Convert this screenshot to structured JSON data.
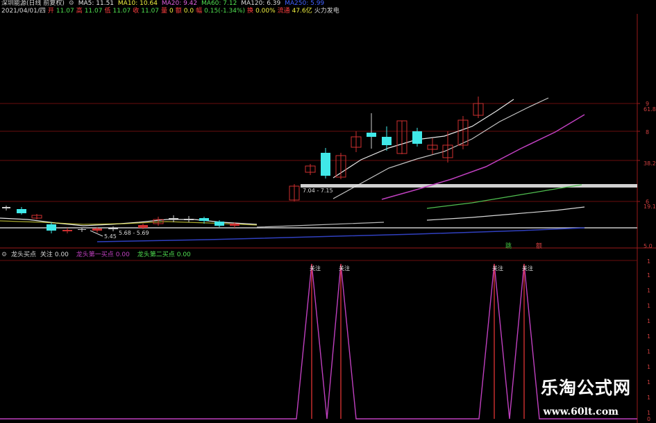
{
  "header": {
    "title": "深圳能源(日线 前复权)",
    "ma": [
      {
        "label": "MA5: 11.51",
        "color": "#e8e8e8"
      },
      {
        "label": "MA10: 10.64",
        "color": "#f0f040"
      },
      {
        "label": "MA20: 9.42",
        "color": "#e060e0"
      },
      {
        "label": "MA60: 7.12",
        "color": "#50e050"
      },
      {
        "label": "MA120: 6.39",
        "color": "#d8d8d8"
      },
      {
        "label": "MA250: 5.99",
        "color": "#4060ff"
      }
    ],
    "date": "2021/04/01/四",
    "open_label": "开",
    "open": "11.07",
    "high_label": "高",
    "high": "11.07",
    "low_label": "低",
    "low": "11.07",
    "close_label": "收",
    "close": "11.07",
    "vol_label": "量",
    "vol": "0",
    "amount_label": "额",
    "amount": "0.0",
    "change_label": "幅",
    "change": "0.15(-1.34%)",
    "turnover_label": "换",
    "turnover": "0.00%",
    "float_label": "流通",
    "float": "47.6亿",
    "sector": "火力发电"
  },
  "price_annotations": {
    "low_price": "5.45",
    "range1": "5.68 - 5.69",
    "range2": "7.04 - 7.15"
  },
  "price_axis": {
    "labels": [
      "9",
      "61.8",
      "8",
      "38.2",
      "6",
      "19.1",
      "5.0"
    ]
  },
  "markers": {
    "pen": "跳",
    "dot": "额"
  },
  "indicator": {
    "name": "龙头买点",
    "focus_label": "关注",
    "focus_value": "0.00",
    "first_label": "龙头第一买点",
    "first_value": "0.00",
    "second_label": "龙头第二买点",
    "second_value": "0.00",
    "spike_label": "关注",
    "axis_labels": [
      "1",
      "1",
      "1",
      "1",
      "1",
      "1",
      "1",
      "1",
      "1",
      "1",
      "1",
      "0"
    ]
  },
  "watermark": {
    "cn": "乐淘公式网",
    "url": "www.60lt.com"
  },
  "colors": {
    "up": "#d03030",
    "down": "#40e8e8",
    "grid": "#7a1010",
    "spike": "#c040c0",
    "spike_stem": "#d03030"
  }
}
